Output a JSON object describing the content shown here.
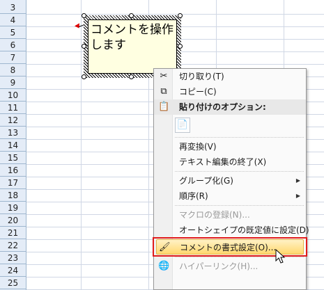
{
  "rows": [
    "3",
    "4",
    "5",
    "6",
    "7",
    "8",
    "9",
    "10",
    "11",
    "12",
    "13",
    "14",
    "15",
    "16",
    "17",
    "18",
    "19",
    "20",
    "21",
    "22",
    "23",
    "24",
    "25"
  ],
  "comment": {
    "text": "コメントを操作します"
  },
  "menu": {
    "items": [
      {
        "label": "切り取り(T)",
        "icon": "scissors-icon",
        "glyph": "✂",
        "enabled": true
      },
      {
        "label": "コピー(C)",
        "icon": "copy-icon",
        "glyph": "⧉",
        "enabled": true
      },
      {
        "label": "貼り付けのオプション:",
        "icon": "clipboard-icon",
        "glyph": "📋",
        "enabled": true,
        "header": true
      },
      {
        "label": "再変換(V)",
        "enabled": true
      },
      {
        "label": "テキスト編集の終了(X)",
        "enabled": true
      },
      {
        "label": "グループ化(G)",
        "enabled": true,
        "submenu": true
      },
      {
        "label": "順序(R)",
        "enabled": true,
        "submenu": true
      },
      {
        "label": "マクロの登録(N)...",
        "enabled": false
      },
      {
        "label": "オートシェイプの既定値に設定(D)",
        "enabled": true
      },
      {
        "label": "コメントの書式設定(O)...",
        "icon": "format-comment-icon",
        "glyph": "🖌",
        "enabled": true,
        "highlighted": true
      },
      {
        "label": "ハイパーリンク(H)...",
        "icon": "hyperlink-icon",
        "glyph": "🌐",
        "enabled": false
      }
    ],
    "paste_option_icon": "paste-clipboard-icon",
    "paste_option_glyph": "📄",
    "submenu_arrow": "▶"
  },
  "colors": {
    "highlight_border": "#e01b1b",
    "comment_bg": "#ffffe1"
  }
}
